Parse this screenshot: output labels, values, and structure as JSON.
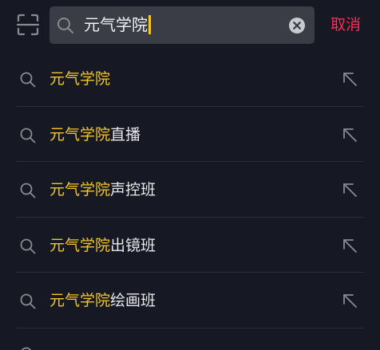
{
  "search": {
    "query": "元气学院",
    "cancel_label": "取消"
  },
  "icons": {
    "scan": "scan-icon",
    "search": "search-icon",
    "clear": "clear-circle-icon",
    "fill": "arrow-up-left-icon"
  },
  "colors": {
    "background": "#161823",
    "search_box": "#3a3c46",
    "highlight": "#f6c624",
    "cancel": "#fe2c55",
    "text": "#e8e8ea",
    "icon": "#8a8b91"
  },
  "suggestions": [
    {
      "highlight": "元气学院",
      "rest": ""
    },
    {
      "highlight": "元气学院",
      "rest": "直播"
    },
    {
      "highlight": "元气学院",
      "rest": "声控班"
    },
    {
      "highlight": "元气学院",
      "rest": "出镜班"
    },
    {
      "highlight": "元气学院",
      "rest": "绘画班"
    }
  ]
}
